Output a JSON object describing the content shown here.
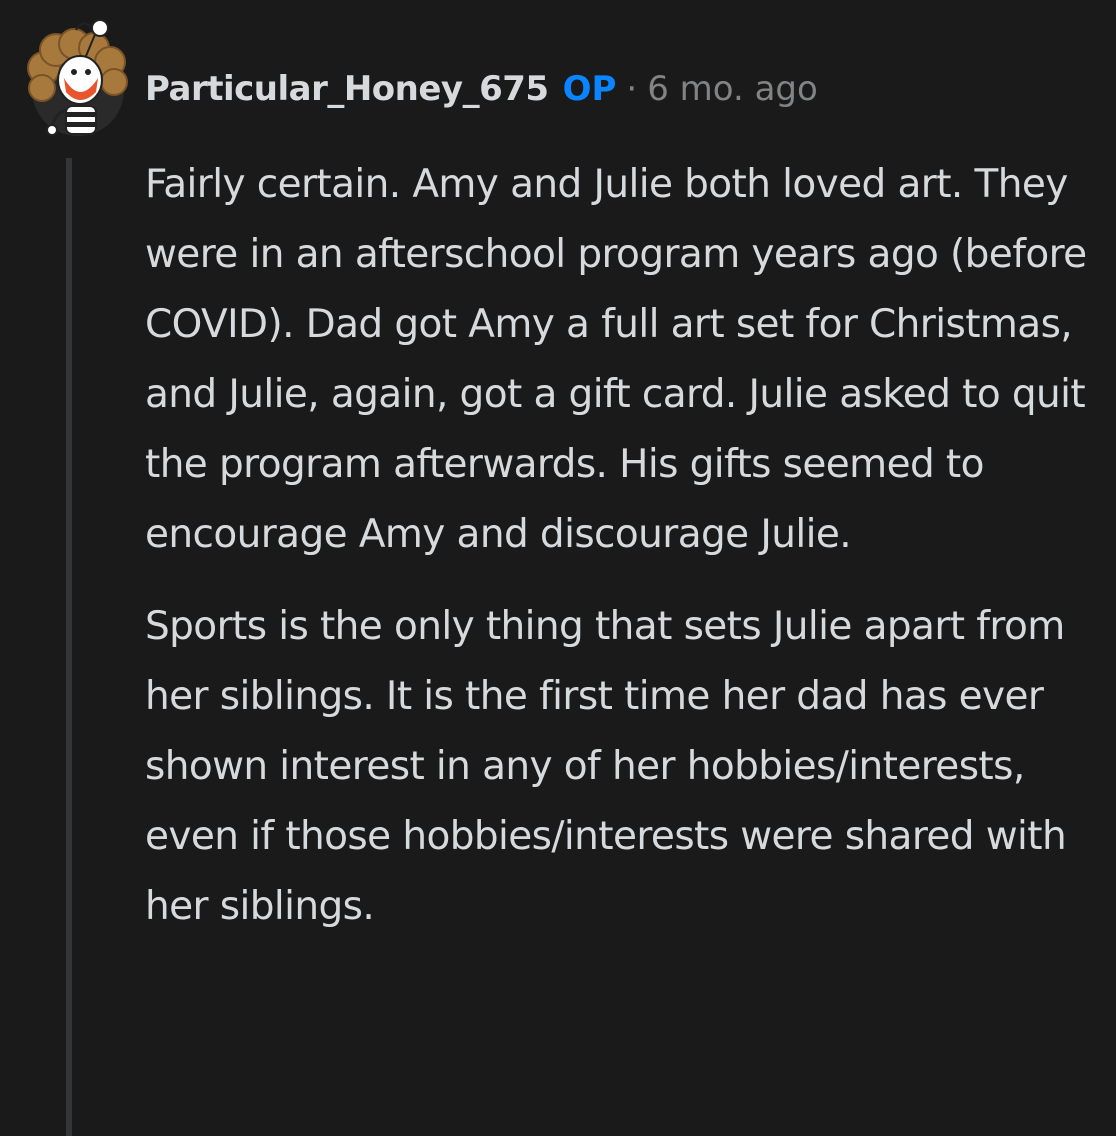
{
  "comment": {
    "author": "Particular_Honey_675",
    "badge": "OP",
    "separator": "·",
    "timestamp": "6 mo. ago",
    "avatar_icon": "snoo-avatar-curly-hair-icon",
    "paragraphs": [
      "Fairly certain. Amy and Julie both loved art. They were in an afterschool program years ago (before COVID). Dad got Amy a full art set for Christmas, and Julie, again, got a gift card. Julie asked to quit the program afterwards. His gifts seemed to encourage Amy and discourage Julie.",
      "Sports is the only thing that sets Julie apart from her siblings. It is the first time her dad has ever shown interest in any of her hobbies/interests, even if those hobbies/interests were shared with her siblings."
    ]
  },
  "colors": {
    "background": "#1a1a1b",
    "text": "#d7dadc",
    "muted": "#818384",
    "op_badge": "#0a84ff",
    "thread_line": "#343536"
  }
}
